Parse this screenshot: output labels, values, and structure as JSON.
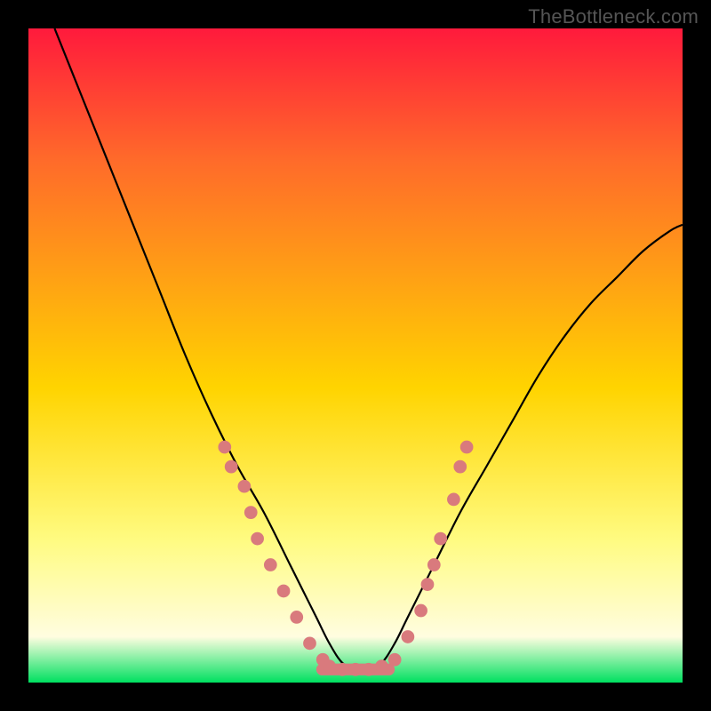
{
  "watermark": "TheBottleneck.com",
  "chart_data": {
    "type": "line",
    "title": "",
    "xlabel": "",
    "ylabel": "",
    "xlim": [
      0,
      100
    ],
    "ylim": [
      0,
      100
    ],
    "background_gradient": [
      "#ff1a3c",
      "#ff6a2a",
      "#ffd400",
      "#fffb80",
      "#fffde0",
      "#00e060"
    ],
    "series": [
      {
        "name": "curve",
        "x": [
          4,
          8,
          12,
          16,
          20,
          24,
          28,
          32,
          36,
          40,
          42,
          44,
          46,
          48,
          50,
          52,
          54,
          56,
          58,
          62,
          66,
          70,
          74,
          78,
          82,
          86,
          90,
          94,
          98,
          100
        ],
        "y": [
          100,
          90,
          80,
          70,
          60,
          50,
          41,
          33,
          26,
          18,
          14,
          10,
          6,
          3,
          2,
          2,
          3,
          6,
          10,
          18,
          26,
          33,
          40,
          47,
          53,
          58,
          62,
          66,
          69,
          70
        ]
      }
    ],
    "markers": {
      "name": "dots",
      "color": "#d97a7d",
      "radius_pct": 1.0,
      "points": [
        {
          "x": 30,
          "y": 36
        },
        {
          "x": 31,
          "y": 33
        },
        {
          "x": 33,
          "y": 30
        },
        {
          "x": 34,
          "y": 26
        },
        {
          "x": 35,
          "y": 22
        },
        {
          "x": 37,
          "y": 18
        },
        {
          "x": 39,
          "y": 14
        },
        {
          "x": 41,
          "y": 10
        },
        {
          "x": 43,
          "y": 6
        },
        {
          "x": 45,
          "y": 3.5
        },
        {
          "x": 46,
          "y": 2.5
        },
        {
          "x": 48,
          "y": 2
        },
        {
          "x": 50,
          "y": 2
        },
        {
          "x": 52,
          "y": 2
        },
        {
          "x": 54,
          "y": 2.5
        },
        {
          "x": 56,
          "y": 3.5
        },
        {
          "x": 58,
          "y": 7
        },
        {
          "x": 60,
          "y": 11
        },
        {
          "x": 61,
          "y": 15
        },
        {
          "x": 62,
          "y": 18
        },
        {
          "x": 63,
          "y": 22
        },
        {
          "x": 65,
          "y": 28
        },
        {
          "x": 66,
          "y": 33
        },
        {
          "x": 67,
          "y": 36
        }
      ]
    },
    "bottom_bar": {
      "color": "#d97a7d",
      "x_start": 44,
      "x_end": 56,
      "y": 2,
      "height_pct": 1.8
    }
  }
}
